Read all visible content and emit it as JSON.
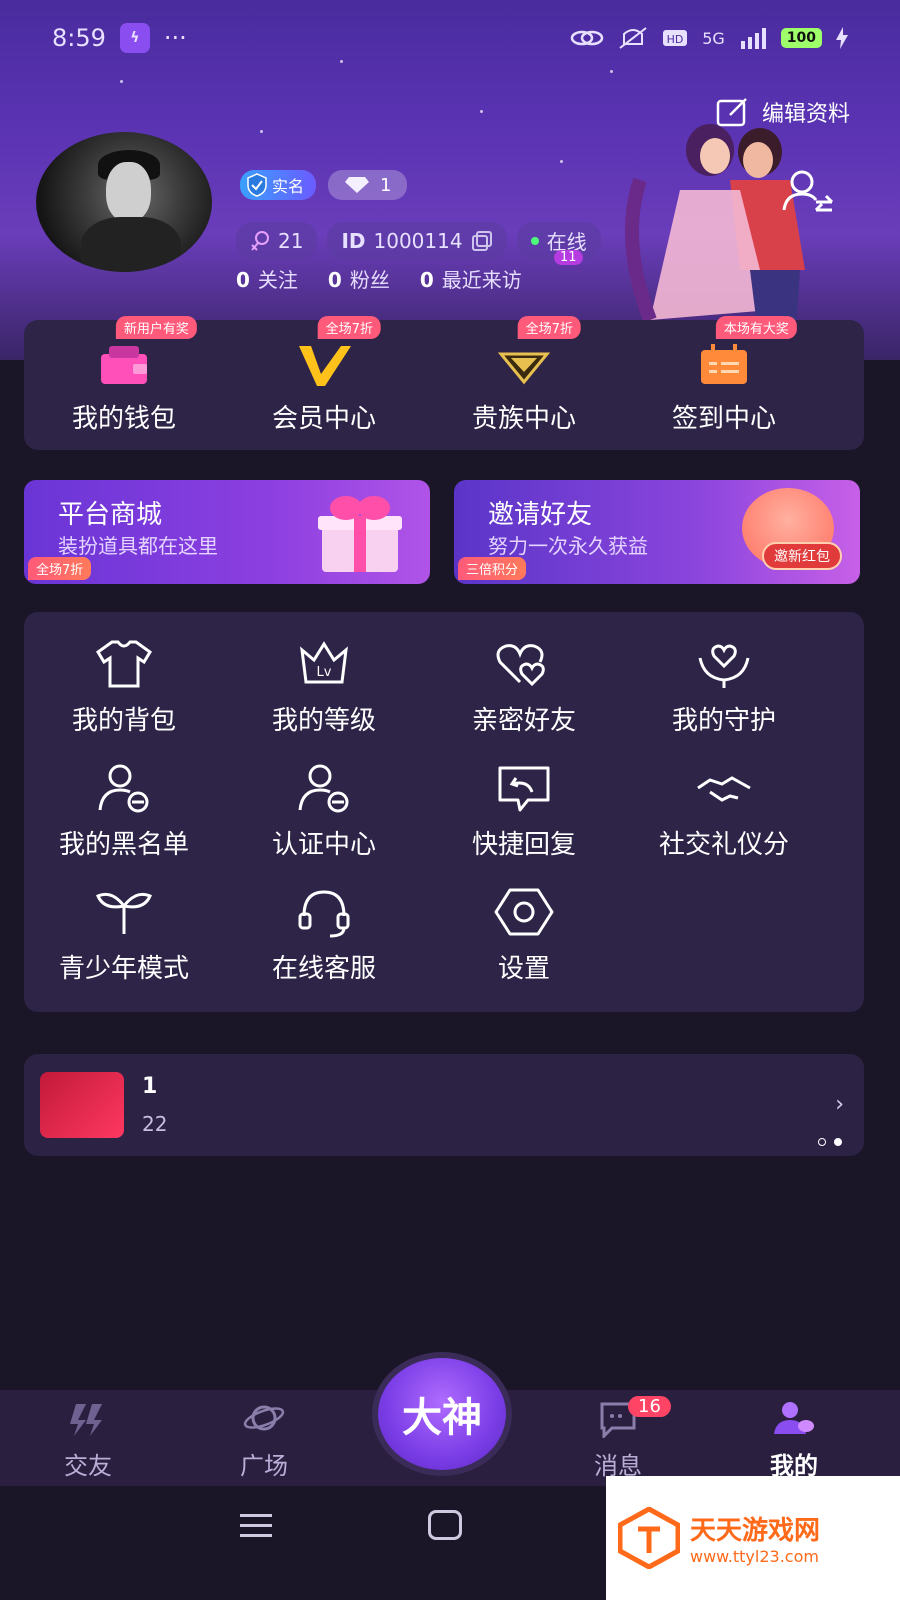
{
  "status_bar": {
    "time": "8:59",
    "app_icon_text": "ϟ",
    "dots": "···",
    "network": "5G",
    "battery": "100"
  },
  "header": {
    "edit_profile": "编辑资料",
    "badge_real": "实名",
    "diamond_count": "1",
    "charm": "21",
    "id_label": "ID",
    "id_value": "1000114",
    "online": "在线",
    "follow_count": "0",
    "follow_label": "关注",
    "fans_count": "0",
    "fans_label": "粉丝",
    "visit_count": "0",
    "visit_label": "最近来访",
    "visit_badge": "11"
  },
  "quick": [
    {
      "label": "我的钱包",
      "tag": "新用户有奖"
    },
    {
      "label": "会员中心",
      "tag": "全场7折"
    },
    {
      "label": "贵族中心",
      "tag": "全场7折"
    },
    {
      "label": "签到中心",
      "tag": "本场有大奖"
    }
  ],
  "promos": {
    "left": {
      "title": "平台商城",
      "sub": "装扮道具都在这里",
      "tag": "全场7折"
    },
    "right": {
      "title": "邀请好友",
      "sub": "努力一次永久获益",
      "tag": "三倍积分",
      "button": "邀新红包"
    }
  },
  "grid": [
    {
      "label": "我的背包",
      "icon": "shirt-icon"
    },
    {
      "label": "我的等级",
      "icon": "level-crown-icon"
    },
    {
      "label": "亲密好友",
      "icon": "hearts-icon"
    },
    {
      "label": "我的守护",
      "icon": "guard-hands-heart-icon"
    },
    {
      "label": "我的黑名单",
      "icon": "user-block-icon"
    },
    {
      "label": "认证中心",
      "icon": "user-verify-icon"
    },
    {
      "label": "快捷回复",
      "icon": "reply-bubble-icon"
    },
    {
      "label": "社交礼仪分",
      "icon": "handshake-icon"
    },
    {
      "label": "青少年模式",
      "icon": "sprout-icon"
    },
    {
      "label": "在线客服",
      "icon": "headset-icon"
    },
    {
      "label": "设置",
      "icon": "settings-hex-icon"
    }
  ],
  "room": {
    "name": "1",
    "sub": "22",
    "arrow": "›"
  },
  "tabbar": {
    "tabs": [
      {
        "label": "交友"
      },
      {
        "label": "广场"
      },
      {
        "label": "消息"
      },
      {
        "label": "我的"
      }
    ],
    "center": "大神",
    "msg_badge": "16"
  },
  "watermark": {
    "title": "天天游戏网",
    "url": "www.ttyl23.com"
  },
  "colors": {
    "accent": "#8a4df0",
    "card_bg": "#2e2447",
    "tag_pink": "#ff5a7a",
    "online": "#4cff7a"
  }
}
